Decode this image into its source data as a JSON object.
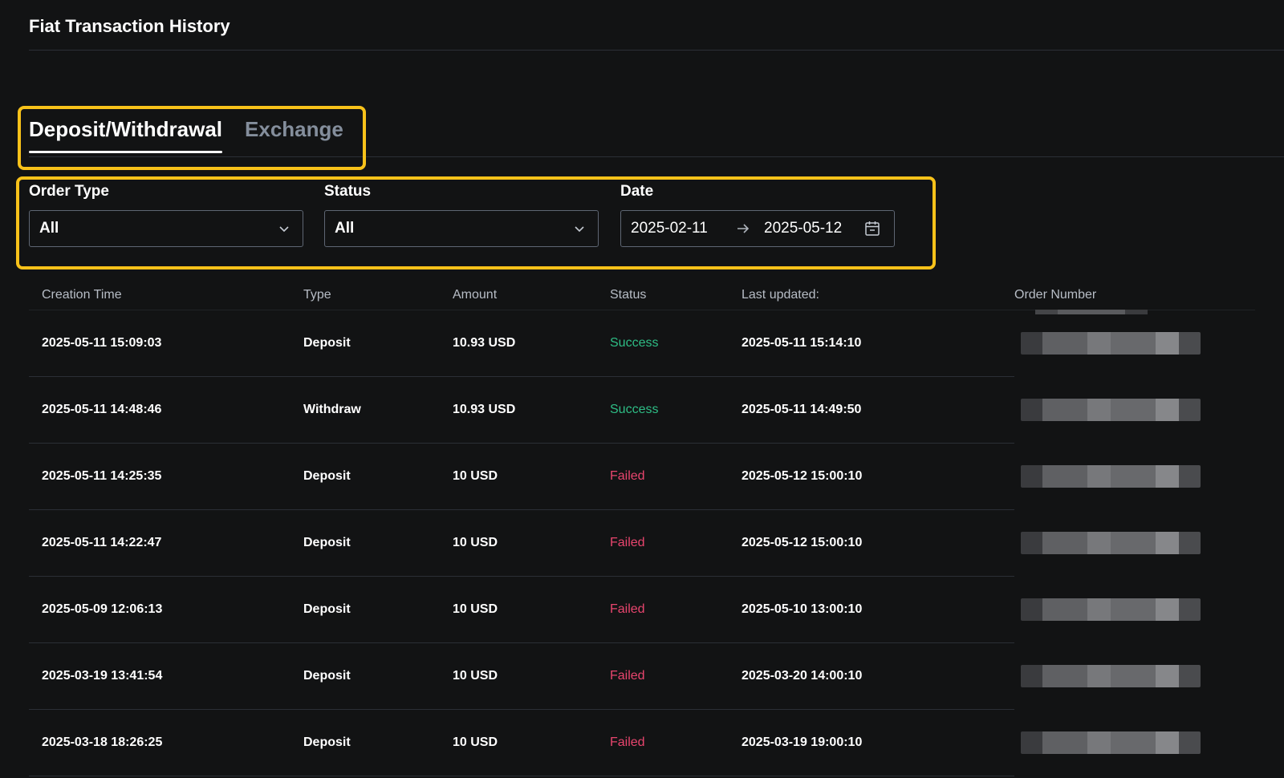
{
  "page": {
    "title": "Fiat Transaction History"
  },
  "tabs": [
    {
      "label": "Deposit/Withdrawal",
      "active": true
    },
    {
      "label": "Exchange",
      "active": false
    }
  ],
  "filters": {
    "order_type": {
      "label": "Order Type",
      "value": "All"
    },
    "status": {
      "label": "Status",
      "value": "All"
    },
    "date": {
      "label": "Date",
      "start": "2025-02-11",
      "end": "2025-05-12"
    }
  },
  "table": {
    "headers": {
      "creation_time": "Creation Time",
      "type": "Type",
      "amount": "Amount",
      "status": "Status",
      "last_updated": "Last updated:",
      "order_number": "Order Number"
    },
    "rows": [
      {
        "creation_time": "2025-05-11 15:09:03",
        "type": "Deposit",
        "amount": "10.93 USD",
        "status": "Success",
        "last_updated": "2025-05-11 15:14:10"
      },
      {
        "creation_time": "2025-05-11 14:48:46",
        "type": "Withdraw",
        "amount": "10.93 USD",
        "status": "Success",
        "last_updated": "2025-05-11 14:49:50"
      },
      {
        "creation_time": "2025-05-11 14:25:35",
        "type": "Deposit",
        "amount": "10 USD",
        "status": "Failed",
        "last_updated": "2025-05-12 15:00:10"
      },
      {
        "creation_time": "2025-05-11 14:22:47",
        "type": "Deposit",
        "amount": "10 USD",
        "status": "Failed",
        "last_updated": "2025-05-12 15:00:10"
      },
      {
        "creation_time": "2025-05-09 12:06:13",
        "type": "Deposit",
        "amount": "10 USD",
        "status": "Failed",
        "last_updated": "2025-05-10 13:00:10"
      },
      {
        "creation_time": "2025-03-19 13:41:54",
        "type": "Deposit",
        "amount": "10 USD",
        "status": "Failed",
        "last_updated": "2025-03-20 14:00:10"
      },
      {
        "creation_time": "2025-03-18 18:26:25",
        "type": "Deposit",
        "amount": "10 USD",
        "status": "Failed",
        "last_updated": "2025-03-19 19:00:10"
      }
    ]
  },
  "colors": {
    "success": "#2ebd85",
    "failed": "#e8456e",
    "highlight": "#f8c21a",
    "background": "#121314"
  }
}
